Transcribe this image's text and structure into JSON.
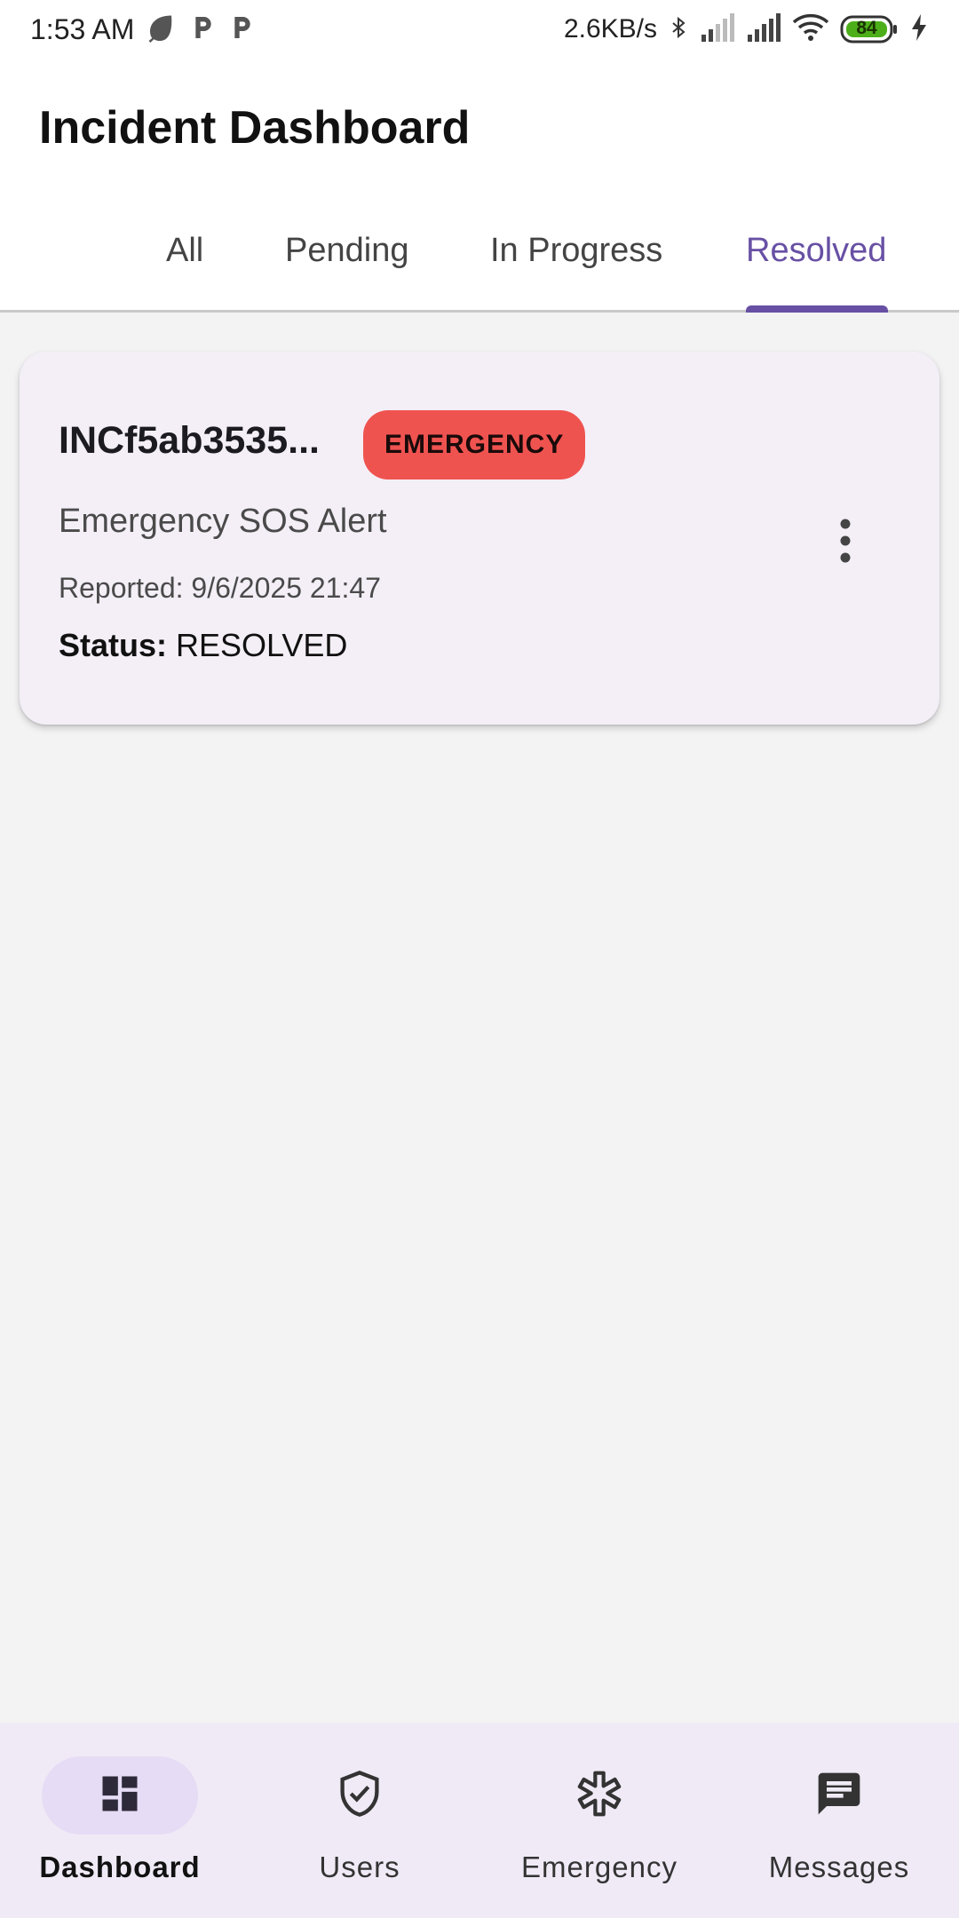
{
  "status_bar": {
    "time": "1:53 AM",
    "network_speed": "2.6KB/s",
    "battery": "84",
    "icons_left": [
      "leaf-icon",
      "p-icon",
      "p-icon"
    ],
    "icons_right": [
      "bluetooth-icon",
      "signal-icon",
      "signal-icon",
      "wifi-icon",
      "battery-icon",
      "charging-icon"
    ]
  },
  "header": {
    "title": "Incident Dashboard"
  },
  "tabs": [
    {
      "label": "All"
    },
    {
      "label": "Pending"
    },
    {
      "label": "In Progress"
    },
    {
      "label": "Resolved"
    }
  ],
  "active_tab": "Resolved",
  "incidents": [
    {
      "id": "INCf5ab3535...",
      "badge": "EMERGENCY",
      "title": "Emergency SOS Alert",
      "reported": "Reported: 9/6/2025 21:47",
      "status_label": "Status:",
      "status_value": "RESOLVED"
    }
  ],
  "bottom_nav": [
    {
      "label": "Dashboard",
      "icon": "dashboard-icon"
    },
    {
      "label": "Users",
      "icon": "shield-check-icon"
    },
    {
      "label": "Emergency",
      "icon": "medical-asterisk-icon"
    },
    {
      "label": "Messages",
      "icon": "message-icon"
    }
  ],
  "colors": {
    "accent": "#6750a4",
    "badge_emergency": "#ef5350",
    "card_bg": "#f4eff7",
    "nav_bg": "#f0eaf6"
  }
}
